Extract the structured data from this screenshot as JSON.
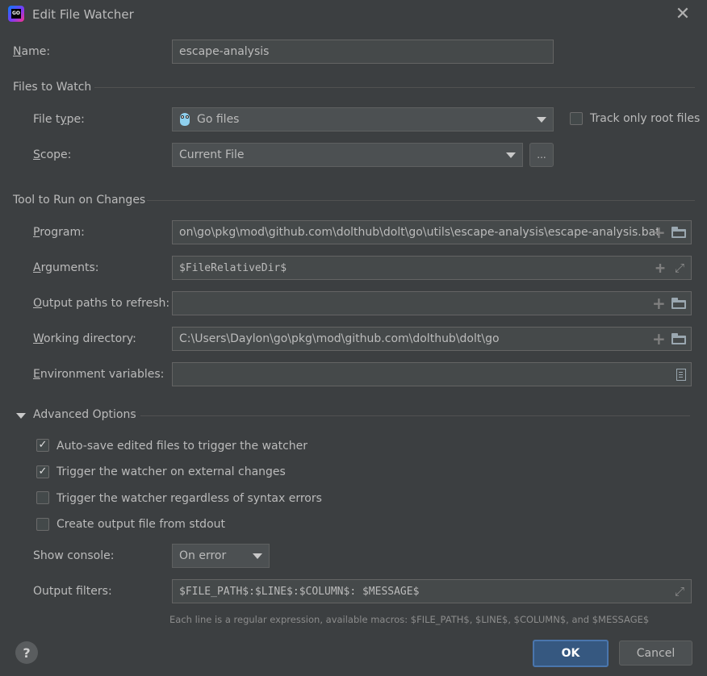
{
  "dialog": {
    "title": "Edit File Watcher",
    "app_icon": "goland-icon",
    "app_icon_text": "GO"
  },
  "name_field": {
    "label": "Name:",
    "value": "escape-analysis"
  },
  "files_to_watch": {
    "section_title": "Files to Watch",
    "file_type": {
      "label": "File type:",
      "value": "Go files",
      "icon": "gopher-icon"
    },
    "track_only_root": {
      "label": "Track only root files",
      "checked": false
    },
    "scope": {
      "label": "Scope:",
      "value": "Current File",
      "browse_label": "..."
    }
  },
  "tool_section": {
    "section_title": "Tool to Run on Changes",
    "program": {
      "label": "Program:",
      "value": "on\\go\\pkg\\mod\\github.com\\dolthub\\dolt\\go\\utils\\escape-analysis\\escape-analysis.bat"
    },
    "arguments": {
      "label": "Arguments:",
      "value": "$FileRelativeDir$"
    },
    "output_paths": {
      "label": "Output paths to refresh:",
      "value": ""
    },
    "working_directory": {
      "label": "Working directory:",
      "value": "C:\\Users\\Daylon\\go\\pkg\\mod\\github.com\\dolthub\\dolt\\go"
    },
    "environment_variables": {
      "label": "Environment variables:",
      "value": ""
    }
  },
  "advanced": {
    "section_title": "Advanced Options",
    "options": [
      {
        "label": "Auto-save edited files to trigger the watcher",
        "checked": true,
        "mark": "✓"
      },
      {
        "label": "Trigger the watcher on external changes",
        "checked": true,
        "mark": "✓"
      },
      {
        "label": "Trigger the watcher regardless of syntax errors",
        "checked": false,
        "mark": ""
      },
      {
        "label": "Create output file from stdout",
        "checked": false,
        "mark": ""
      }
    ],
    "show_console": {
      "label": "Show console:",
      "value": "On error"
    },
    "output_filters": {
      "label": "Output filters:",
      "value": "$FILE_PATH$:$LINE$:$COLUMN$: $MESSAGE$"
    },
    "hint": "Each line is a regular expression, available macros: $FILE_PATH$, $LINE$, $COLUMN$, and $MESSAGE$"
  },
  "buttons": {
    "help": "?",
    "ok": "OK",
    "cancel": "Cancel"
  },
  "colors": {
    "background": "#3c3f41",
    "field": "#45494a",
    "accent": "#365880",
    "text": "#bbbbbb"
  }
}
